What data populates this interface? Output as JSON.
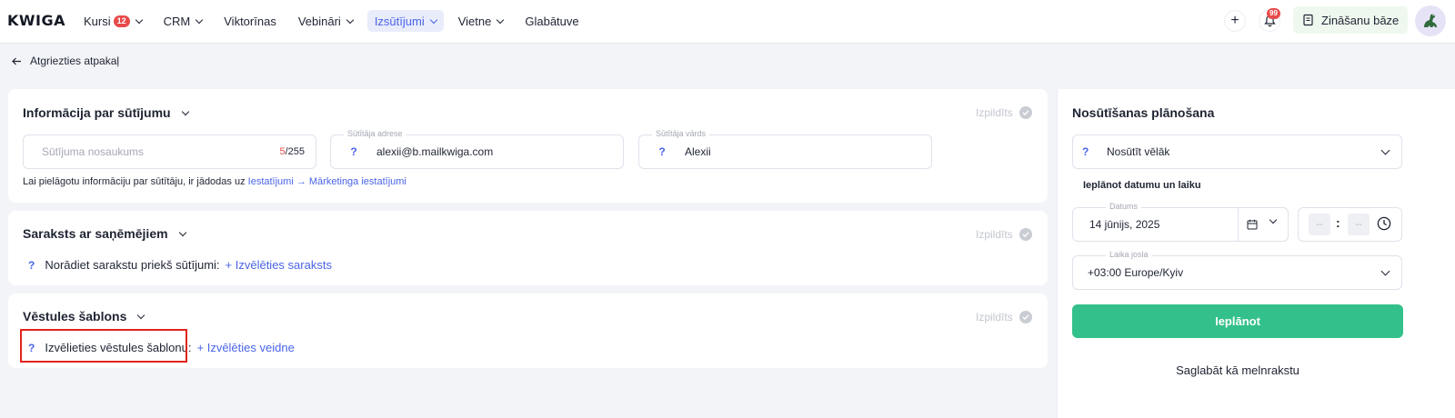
{
  "app": {
    "logo": "KWIGA"
  },
  "nav": {
    "items": [
      {
        "label": "Kursi",
        "badge": "12",
        "has_dropdown": true
      },
      {
        "label": "CRM",
        "has_dropdown": true
      },
      {
        "label": "Viktorīnas",
        "has_dropdown": false
      },
      {
        "label": "Vebināri",
        "has_dropdown": true
      },
      {
        "label": "Izsūtījumi",
        "has_dropdown": true,
        "active": true
      },
      {
        "label": "Vietne",
        "has_dropdown": true
      },
      {
        "label": "Glabātuve",
        "has_dropdown": false
      }
    ],
    "plus_icon": "+",
    "notifications_count": "99",
    "knowledge_base_label": "Zināšanu bāze"
  },
  "back": {
    "label": "Atgriezties atpakaļ"
  },
  "info_section": {
    "title": "Informācija par sūtījumu",
    "status": "Izpildīts",
    "name_field": {
      "placeholder": "Sūtījuma nosaukums",
      "counter_current": "5",
      "counter_max": "/255"
    },
    "sender_address": {
      "label": "Sūtītāja adrese",
      "help": "?",
      "value": "alexii@b.mailkwiga.com"
    },
    "sender_name": {
      "label": "Sūtītāja vārds",
      "help": "?",
      "value": "Alexii"
    },
    "hint_prefix": "Lai pielāgotu informāciju par sūtītāju, ir jādodas uz ",
    "hint_link": "Iestatījumi → Mārketinga iestatījumi"
  },
  "recipients_section": {
    "title": "Saraksts ar saņēmējiem",
    "status": "Izpildīts",
    "help": "?",
    "label": "Norādiet sarakstu priekš sūtījumi:",
    "link": "+ Izvēlēties saraksts"
  },
  "template_section": {
    "title": "Vēstules šablons",
    "status": "Izpildīts",
    "help": "?",
    "label": "Izvēlieties vēstules šablonu:",
    "link": "+ Izvēlēties veidne"
  },
  "schedule": {
    "title": "Nosūtīšanas plānošana",
    "mode_help": "?",
    "mode": "Nosūtīt vēlāk",
    "plan_label": "Ieplānot datumu un laiku",
    "date_label": "Datums",
    "date_value": "14 jūnijs, 2025",
    "hour_placeholder": "--",
    "minute_placeholder": "--",
    "time_separator": ":",
    "timezone_label": "Laika josla",
    "timezone_value": "+03:00 Europe/Kyiv",
    "submit_label": "Ieplānot",
    "draft_label": "Saglabāt kā melnrakstu"
  },
  "colors": {
    "accent": "#4a64e8",
    "primary_button": "#33c08a",
    "badge": "#e84a4a",
    "highlight": "#e0241c"
  }
}
